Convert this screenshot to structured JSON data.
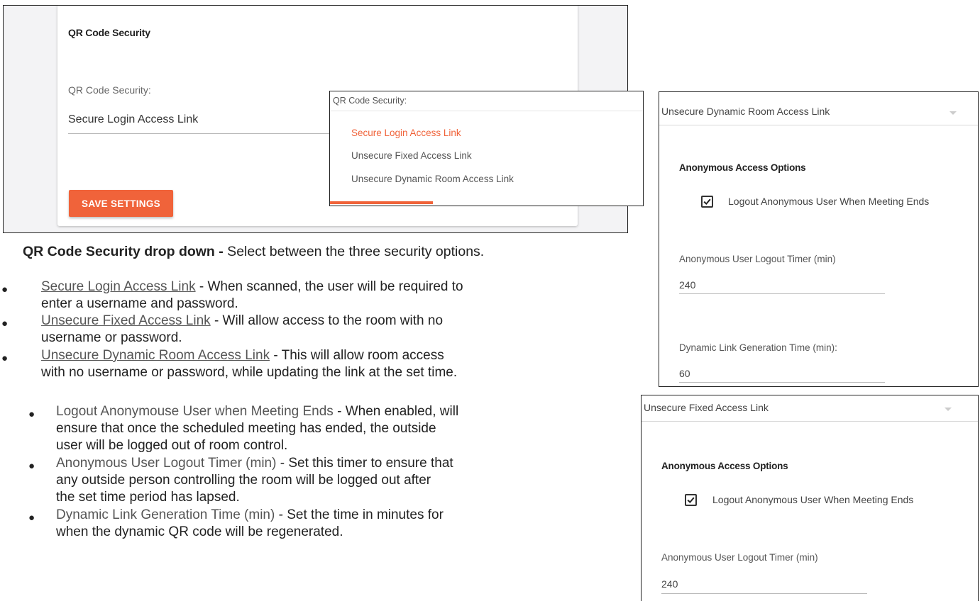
{
  "settings_card": {
    "title": "QR Code Security",
    "field_label": "QR Code Security:",
    "field_value": "Secure Login Access Link",
    "save_button": "SAVE SETTINGS"
  },
  "dropdown": {
    "label": "QR Code Security:",
    "selected_color": "#f0633a",
    "options": [
      "Secure Login Access Link",
      "Unsecure Fixed Access Link",
      "Unsecure Dynamic Room Access Link"
    ]
  },
  "doc": {
    "heading_bold": "QR Code Security drop down -",
    "heading_rest": " Select between the three security options.",
    "bullets": [
      {
        "term": "Secure Login Access Link",
        "desc_1": " - When scanned, the user will be required to",
        "desc_2": "enter a username and password."
      },
      {
        "term": "Unsecure Fixed Access Link",
        "desc_1": " - Will allow access to the room with no",
        "desc_2": "username or password."
      },
      {
        "term": "Unsecure Dynamic Room Access Link",
        "desc_1": " - This will allow room access",
        "desc_2": "with no username or password, while updating the link at the set time."
      }
    ],
    "sub_bullets": [
      {
        "term": "Logout Anonymouse User when Meeting Ends",
        "desc_1": " - When enabled, will",
        "desc_2": "ensure that once the scheduled meeting has ended, the outside",
        "desc_3": "user will be logged out of room control."
      },
      {
        "term": "Anonymous User Logout Timer (min)",
        "desc_1": " - Set this timer to ensure that",
        "desc_2": "any outside person controlling the room will be logged out after",
        "desc_3": "the set time period has lapsed."
      },
      {
        "term": "Dynamic Link Generation Time (min)",
        "desc_1": " - Set the time in minutes for",
        "desc_2": "when the dynamic QR code will be regenerated."
      }
    ]
  },
  "dynamic_panel": {
    "select_value": "Unsecure Dynamic Room Access Link",
    "section_title": "Anonymous Access Options",
    "checkbox_label": "Logout Anonymous User When Meeting Ends",
    "checkbox_checked": true,
    "timer_label": "Anonymous User Logout Timer (min)",
    "timer_value": "240",
    "gen_label": "Dynamic Link Generation Time (min):",
    "gen_value": "60"
  },
  "fixed_panel": {
    "select_value": "Unsecure Fixed Access Link",
    "section_title": "Anonymous Access Options",
    "checkbox_label": "Logout Anonymous User When Meeting Ends",
    "checkbox_checked": true,
    "timer_label": "Anonymous User Logout Timer (min)",
    "timer_value": "240"
  }
}
